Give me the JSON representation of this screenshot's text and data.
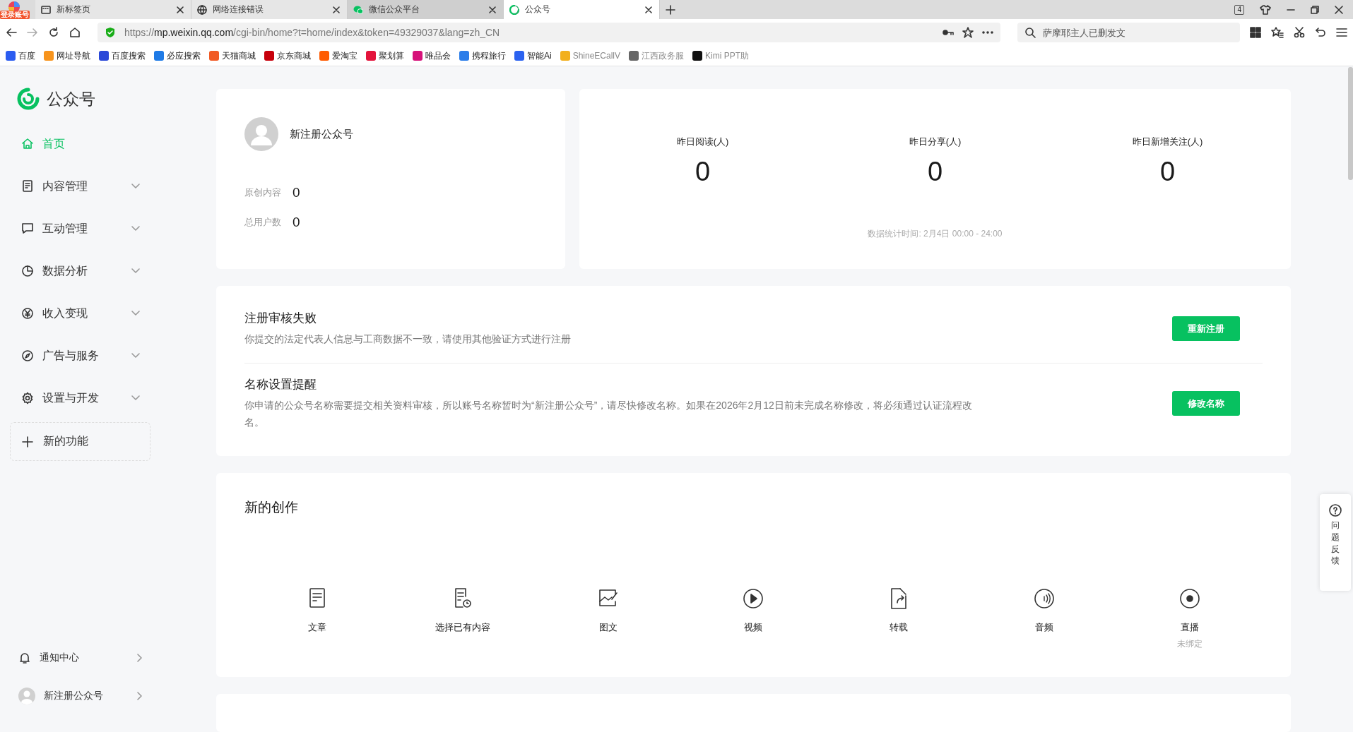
{
  "browser": {
    "profile_badge": "登录账号",
    "tab_count": "4",
    "tabs": [
      {
        "title": "新标签页",
        "selected": false,
        "hovered": false
      },
      {
        "title": "网络连接错误",
        "selected": false,
        "hovered": false
      },
      {
        "title": "微信公众平台",
        "selected": false,
        "hovered": true
      },
      {
        "title": "公众号",
        "selected": true,
        "hovered": false
      }
    ],
    "url": {
      "scheme": "https://",
      "host": "mp.weixin.qq.com",
      "path": "/cgi-bin/home?t=home/index&token=49329037&lang=zh_CN"
    },
    "search": {
      "placeholder": "萨摩耶主人已删发文"
    },
    "bookmarks": [
      {
        "title": "百度",
        "faded": false
      },
      {
        "title": "网址导航",
        "faded": false
      },
      {
        "title": "百度搜索",
        "faded": false
      },
      {
        "title": "必应搜索",
        "faded": false
      },
      {
        "title": "天猫商城",
        "faded": false
      },
      {
        "title": "京东商城",
        "faded": false
      },
      {
        "title": "爱淘宝",
        "faded": false
      },
      {
        "title": "聚划算",
        "faded": false
      },
      {
        "title": "唯品会",
        "faded": false
      },
      {
        "title": "携程旅行",
        "faded": false
      },
      {
        "title": "智能Ai",
        "faded": false
      },
      {
        "title": "ShineECallV",
        "faded": true
      },
      {
        "title": "江西政务服",
        "faded": true
      },
      {
        "title": "Kimi PPT助",
        "faded": true
      }
    ]
  },
  "sidebar": {
    "brand": "公众号",
    "items": [
      {
        "label": "首页",
        "kind": "link",
        "selected": true
      },
      {
        "label": "内容管理",
        "kind": "group",
        "selected": false,
        "expanded": false
      },
      {
        "label": "互动管理",
        "kind": "group",
        "selected": false,
        "expanded": false
      },
      {
        "label": "数据分析",
        "kind": "group",
        "selected": false,
        "expanded": false
      },
      {
        "label": "收入变现",
        "kind": "group",
        "selected": false,
        "expanded": false
      },
      {
        "label": "广告与服务",
        "kind": "group",
        "selected": false,
        "expanded": false
      },
      {
        "label": "设置与开发",
        "kind": "group",
        "selected": false,
        "expanded": false
      }
    ],
    "new_feature": "新的功能",
    "bottom": [
      {
        "label": "通知中心"
      },
      {
        "label": "新注册公众号"
      }
    ]
  },
  "account": {
    "name": "新注册公众号",
    "stats": [
      {
        "label": "原创内容",
        "value": "0"
      },
      {
        "label": "总用户数",
        "value": "0"
      }
    ]
  },
  "overview": {
    "stats": [
      {
        "label": "昨日阅读(人)",
        "value": "0"
      },
      {
        "label": "昨日分享(人)",
        "value": "0"
      },
      {
        "label": "昨日新增关注(人)",
        "value": "0"
      }
    ],
    "note": "数据统计时间: 2月4日 00:00 - 24:00"
  },
  "notices": [
    {
      "title": "注册审核失败",
      "text": "你提交的法定代表人信息与工商数据不一致，请使用其他验证方式进行注册",
      "button": "重新注册"
    },
    {
      "title": "名称设置提醒",
      "text": "你申请的公众号名称需要提交相关资料审核，所以账号名称暂时为“新注册公众号”，请尽快修改名称。如果在2026年2月12日前未完成名称修改，将必须通过认证流程改名。",
      "button": "修改名称"
    }
  ],
  "creation": {
    "title": "新的创作",
    "items": [
      {
        "label": "文章"
      },
      {
        "label": "选择已有内容"
      },
      {
        "label": "图文"
      },
      {
        "label": "视频"
      },
      {
        "label": "转载"
      },
      {
        "label": "音频"
      },
      {
        "label": "直播",
        "sub": "未绑定"
      }
    ]
  },
  "feedback": {
    "label": "问题反馈"
  }
}
